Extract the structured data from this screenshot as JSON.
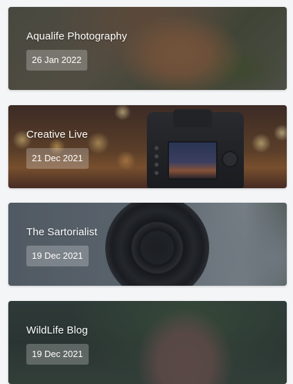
{
  "cards": [
    {
      "title": "Aqualife Photography",
      "date": "26 Jan 2022"
    },
    {
      "title": "Creative Live",
      "date": "21 Dec 2021"
    },
    {
      "title": "The Sartorialist",
      "date": "19 Dec 2021"
    },
    {
      "title": "WildLife Blog",
      "date": "19 Dec 2021"
    }
  ]
}
